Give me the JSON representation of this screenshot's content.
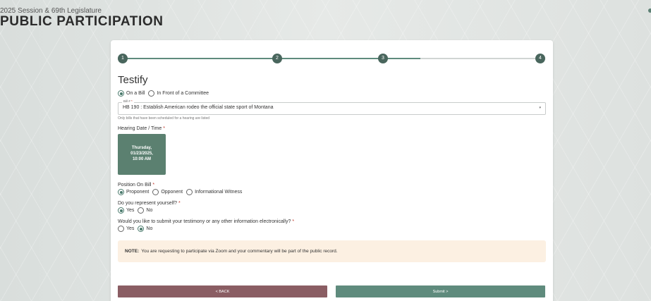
{
  "header": {
    "session": "2025 Session & 69th Legislature",
    "title": "PUBLIC PARTICIPATION"
  },
  "stepper": {
    "steps": [
      "1",
      "2",
      "3",
      "4"
    ],
    "current_step": 3
  },
  "form": {
    "heading": "Testify",
    "testify_options": [
      {
        "label": "On a Bill",
        "selected": true
      },
      {
        "label": "In Front of a Committee",
        "selected": false
      }
    ],
    "bill": {
      "legend": "Bill #",
      "required_mark": "*",
      "value": "HB 190 : Establish American rodeo the official state sport of Montana",
      "caret": "▾",
      "hint": "Only bills that have been scheduled for a hearing are listed"
    },
    "hearing": {
      "label": "Hearing Date / Time",
      "required_mark": "*",
      "day": "Thursday,",
      "date": "01/23/2025,",
      "time": "10:00 AM"
    },
    "position": {
      "label": "Position On Bill",
      "required_mark": "*",
      "options": [
        {
          "label": "Proponent",
          "selected": true
        },
        {
          "label": "Opponent",
          "selected": false
        },
        {
          "label": "Informational Witness",
          "selected": false
        }
      ]
    },
    "represent": {
      "label": "Do you represent yourself?",
      "required_mark": "*",
      "options": [
        {
          "label": "Yes",
          "selected": true
        },
        {
          "label": "No",
          "selected": false
        }
      ]
    },
    "electronic": {
      "label": "Would you like to submit your testimony or any other information electronically?",
      "required_mark": "*",
      "options": [
        {
          "label": "Yes",
          "selected": false
        },
        {
          "label": "No",
          "selected": true
        }
      ]
    },
    "note": {
      "prefix": "NOTE:",
      "text": "You are requesting to participate via Zoom and your commentary will be part of the public record."
    }
  },
  "buttons": {
    "back": "< BACK",
    "submit": "Submit >"
  },
  "colors": {
    "accent": "#5f8b7d",
    "back_button": "#8a5d63",
    "date_tile": "#5b8070",
    "note_bg": "#fcf0e2"
  }
}
